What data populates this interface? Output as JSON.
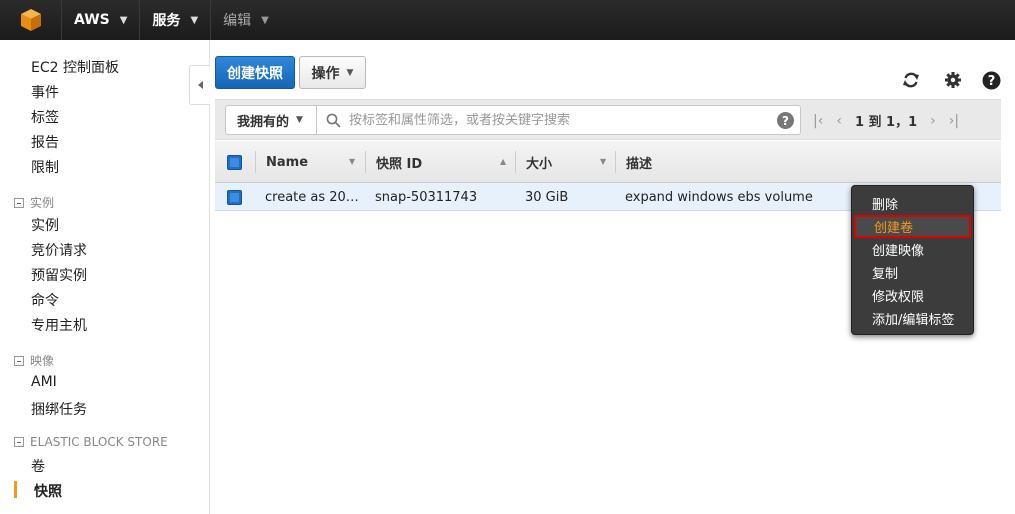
{
  "topbar": {
    "brand": "AWS",
    "services": "服务",
    "edit": "编辑"
  },
  "sidebar": {
    "items_top": [
      "EC2 控制面板",
      "事件",
      "标签",
      "报告",
      "限制"
    ],
    "sections": [
      {
        "title": "实例",
        "items": [
          "实例",
          "竞价请求",
          "预留实例",
          "命令",
          "专用主机"
        ]
      },
      {
        "title": "映像",
        "items": [
          "AMI",
          "捆绑任务"
        ]
      },
      {
        "title": "ELASTIC BLOCK STORE",
        "items": [
          "卷",
          "快照"
        ]
      }
    ],
    "active": "快照"
  },
  "toolbar": {
    "create_label": "创建快照",
    "actions_label": "操作"
  },
  "filter": {
    "owner": "我拥有的",
    "search_placeholder": "按标签和属性筛选，或者按关键字搜索",
    "pager": "1 到 1，1"
  },
  "table": {
    "headers": [
      "Name",
      "快照 ID",
      "大小",
      "描述"
    ],
    "rows": [
      {
        "name": "create as 20…",
        "snapshot_id": "snap-50311743",
        "size": "30 GiB",
        "description": "expand windows ebs volume"
      }
    ]
  },
  "context_menu": {
    "items": [
      "删除",
      "创建卷",
      "创建映像",
      "复制",
      "修改权限",
      "添加/编辑标签"
    ],
    "highlighted_index": 1
  },
  "colors": {
    "topbar": "#1f1f1f",
    "primary": "#1f6fc6",
    "accent": "#f7981d",
    "highlight_border": "#e00000"
  }
}
